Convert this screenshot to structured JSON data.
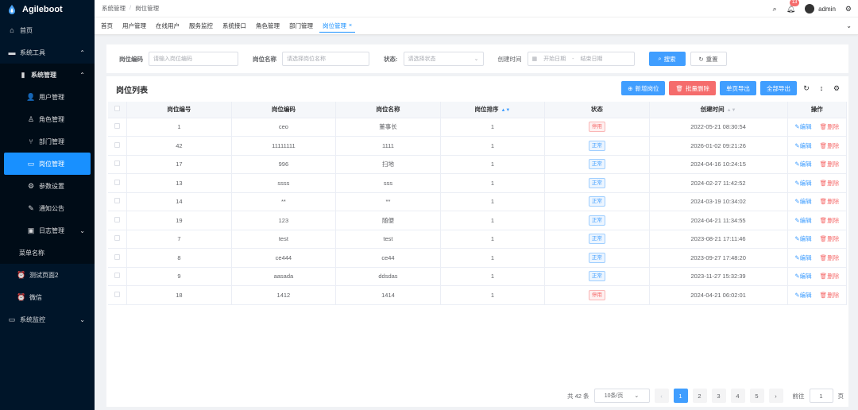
{
  "app": {
    "name": "Agileboot"
  },
  "sidebar": {
    "items": [
      {
        "label": "首页",
        "icon": "home-icon"
      },
      {
        "label": "系统工具",
        "icon": "toolbox-icon"
      },
      {
        "label": "系统管理",
        "icon": "management-icon"
      },
      {
        "label": "用户管理",
        "icon": "user-icon"
      },
      {
        "label": "角色管理",
        "icon": "role-icon"
      },
      {
        "label": "部门管理",
        "icon": "tree-icon"
      },
      {
        "label": "岗位管理",
        "icon": "post-icon"
      },
      {
        "label": "参数设置",
        "icon": "gear-icon"
      },
      {
        "label": "通知公告",
        "icon": "notice-icon"
      },
      {
        "label": "日志管理",
        "icon": "log-icon"
      },
      {
        "label": "菜单名称",
        "icon": ""
      },
      {
        "label": "测试页面2",
        "icon": "alarm-icon"
      },
      {
        "label": "微信",
        "icon": "alarm-icon"
      },
      {
        "label": "系统监控",
        "icon": "monitor-icon"
      }
    ]
  },
  "header": {
    "breadcrumb": [
      "系统管理",
      "岗位管理"
    ],
    "notification_count": "13",
    "username": "admin"
  },
  "tags": [
    "首页",
    "用户管理",
    "在线用户",
    "服务监控",
    "系统接口",
    "角色管理",
    "部门管理",
    "岗位管理"
  ],
  "search": {
    "post_code_label": "岗位编码",
    "post_code_placeholder": "请输入岗位编码",
    "post_name_label": "岗位名称",
    "post_name_placeholder": "请选择岗位名称",
    "status_label": "状态:",
    "status_placeholder": "请选择状态",
    "created_label": "创建时间",
    "start_placeholder": "开始日期",
    "date_sep": "-",
    "end_placeholder": "结束日期",
    "search_btn": "搜索",
    "reset_btn": "重置"
  },
  "table": {
    "title": "岗位列表",
    "add_btn": "新增岗位",
    "batch_delete_btn": "批量删除",
    "export_page_btn": "单页导出",
    "export_all_btn": "全部导出",
    "headers": [
      "岗位编号",
      "岗位编码",
      "岗位名称",
      "岗位排序",
      "状态",
      "创建时间",
      "操作"
    ],
    "edit_label": "编辑",
    "delete_label": "删除",
    "rows": [
      {
        "id": "1",
        "code": "ceo",
        "name": "董事长",
        "sort": "1",
        "status": "停用",
        "created": "2022-05-21 08:30:54"
      },
      {
        "id": "42",
        "code": "11111111",
        "name": "1111",
        "sort": "1",
        "status": "正常",
        "created": "2026-01-02 09:21:26"
      },
      {
        "id": "17",
        "code": "996",
        "name": "扫地",
        "sort": "1",
        "status": "正常",
        "created": "2024-04-16 10:24:15"
      },
      {
        "id": "13",
        "code": "ssss",
        "name": "sss",
        "sort": "1",
        "status": "正常",
        "created": "2024-02-27 11:42:52"
      },
      {
        "id": "14",
        "code": "**",
        "name": "**",
        "sort": "1",
        "status": "正常",
        "created": "2024-03-19 10:34:02"
      },
      {
        "id": "19",
        "code": "123",
        "name": "随便",
        "sort": "1",
        "status": "正常",
        "created": "2024-04-21 11:34:55"
      },
      {
        "id": "7",
        "code": "test",
        "name": "test",
        "sort": "1",
        "status": "正常",
        "created": "2023-08-21 17:11:46"
      },
      {
        "id": "8",
        "code": "ce444",
        "name": "ce44",
        "sort": "1",
        "status": "正常",
        "created": "2023-09-27 17:48:20"
      },
      {
        "id": "9",
        "code": "aasada",
        "name": "ddsdas",
        "sort": "1",
        "status": "正常",
        "created": "2023-11-27 15:32:39"
      },
      {
        "id": "18",
        "code": "1412",
        "name": "1414",
        "sort": "1",
        "status": "停用",
        "created": "2024-04-21 06:02:01"
      }
    ]
  },
  "pagination": {
    "total_text": "共 42 条",
    "page_size": "10条/页",
    "pages": [
      "1",
      "2",
      "3",
      "4",
      "5"
    ],
    "current": "1",
    "goto_label": "前往",
    "goto_value": "1",
    "page_unit": "页"
  },
  "colors": {
    "primary": "#409eff",
    "danger": "#f56c6c",
    "sidebar": "#001529",
    "sidebar_active": "#1890ff"
  }
}
